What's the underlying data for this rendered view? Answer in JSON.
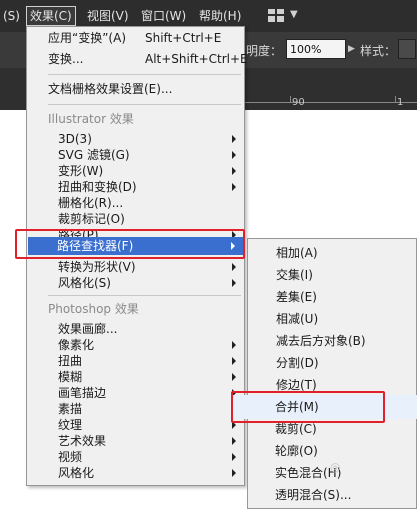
{
  "menubar": {
    "items": [
      "(S)",
      "效果(C)",
      "视图(V)",
      "窗口(W)",
      "帮助(H)"
    ],
    "workspace_icon": "grid-icon",
    "chevron_icon": "chevron-down-icon"
  },
  "controlbar": {
    "opacity_label": "明度：",
    "opacity_value": "100%",
    "style_label": "样式："
  },
  "ruler": {
    "mark": "90",
    "mark2": "1"
  },
  "effect_menu": {
    "apply_last": "应用“变换”(A)",
    "apply_last_shortcut": "Shift+Ctrl+E",
    "transform": "变换...",
    "transform_shortcut": "Alt+Shift+Ctrl+E",
    "raster_settings": "文档栅格效果设置(E)...",
    "illustrator_header": "Illustrator 效果",
    "illustrator_items": [
      "3D(3)",
      "SVG 滤镜(G)",
      "变形(W)",
      "扭曲和变换(D)",
      "栅格化(R)...",
      "裁剪标记(O)",
      "路径(P)",
      "路径查找器(F)",
      "转换为形状(V)",
      "风格化(S)"
    ],
    "photoshop_header": "Photoshop 效果",
    "photoshop_items": [
      "效果画廊...",
      "像素化",
      "扭曲",
      "模糊",
      "画笔描边",
      "素描",
      "纹理",
      "艺术效果",
      "视频",
      "风格化"
    ]
  },
  "pathfinder_submenu": {
    "items": [
      "相加(A)",
      "交集(I)",
      "差集(E)",
      "相减(U)",
      "减去后方对象(B)",
      "分割(D)",
      "修边(T)",
      "合并(M)",
      "裁剪(C)",
      "轮廓(O)",
      "实色混合(H)",
      "透明混合(S)..."
    ]
  },
  "colors": {
    "highlight": "#3a6fcf",
    "annotation": "#e0202a",
    "menubar": "#2d2d2d"
  }
}
